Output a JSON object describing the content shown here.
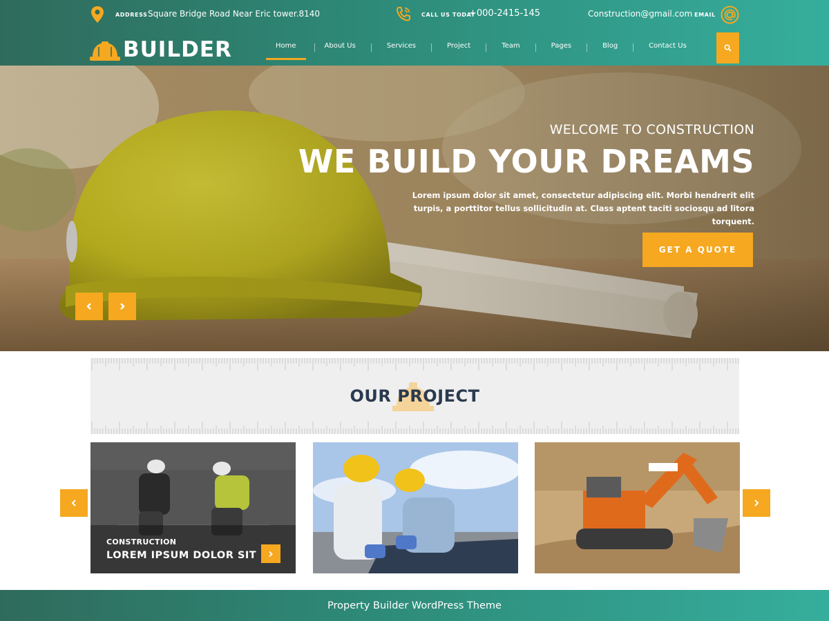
{
  "topbar": {
    "address_label": "ADDRESS",
    "address": "Square Bridge Road Near Eric tower.8140",
    "call_label": "CALL US TODAY",
    "phone": "+000-2415-145",
    "email": "Construction@gmail.com",
    "email_label": "EMAIL"
  },
  "logo": {
    "text": "BUILDER"
  },
  "nav": {
    "items": [
      "Home",
      "About Us",
      "Services",
      "Project",
      "Team",
      "Pages",
      "Blog",
      "Contact Us"
    ],
    "active": "Home"
  },
  "hero": {
    "subtitle": "WELCOME TO CONSTRUCTION",
    "title": "WE BUILD YOUR DREAMS",
    "description": "Lorem ipsum dolor sit amet, consectetur adipiscing elit. Morbi hendrerit elit turpis, a porttitor tellus sollicitudin at. Class aptent taciti sociosqu ad litora torquent.",
    "button": "GET A QUOTE"
  },
  "projects": {
    "title": "OUR PROJECT",
    "cards": [
      {
        "category": "CONSTRUCTION",
        "title": "LOREM IPSUM DOLOR SIT"
      }
    ]
  },
  "footer": {
    "text": "Property Builder WordPress Theme"
  },
  "colors": {
    "accent": "#f5a820",
    "teal_dark": "#2f6b5c",
    "teal_light": "#36ae9d",
    "title_dark": "#2a3a4f"
  }
}
